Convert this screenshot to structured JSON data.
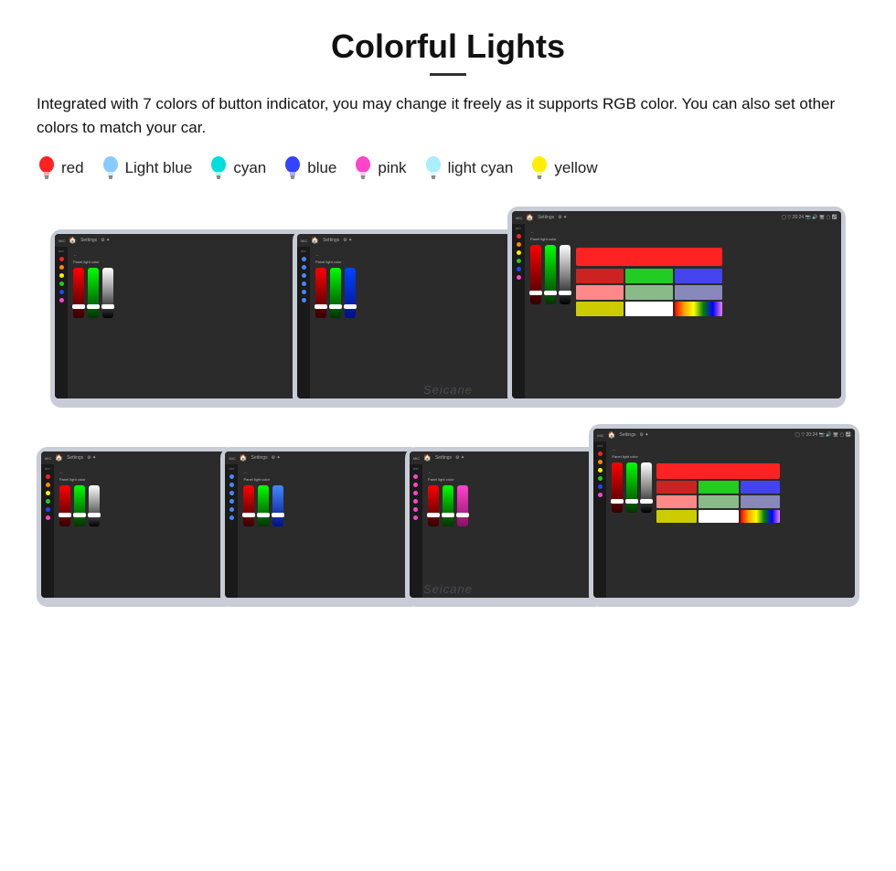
{
  "header": {
    "title": "Colorful Lights",
    "description": "Integrated with 7 colors of button indicator, you may change it freely as it supports RGB color. You can also set other colors to match your car."
  },
  "colors": [
    {
      "name": "red",
      "color": "#ff2222",
      "fill": "#ff2222"
    },
    {
      "name": "Light blue",
      "color": "#88ccff",
      "fill": "#88ccff"
    },
    {
      "name": "cyan",
      "color": "#00dddd",
      "fill": "#00dddd"
    },
    {
      "name": "blue",
      "color": "#3344ff",
      "fill": "#3344ff"
    },
    {
      "name": "pink",
      "color": "#ff44cc",
      "fill": "#ff44cc"
    },
    {
      "name": "light cyan",
      "color": "#aaeeff",
      "fill": "#aaeeff"
    },
    {
      "name": "yellow",
      "color": "#ffee00",
      "fill": "#ffee00"
    }
  ],
  "watermark1": "Seicane",
  "watermark2": "Seicane",
  "screen": {
    "panel_label": "Panel light color",
    "settings": "Settings"
  },
  "sidebar_colors_row1": [
    "#ff2222",
    "#ff8800",
    "#ffee00",
    "#22cc22",
    "#2244ff",
    "#ff44cc"
  ],
  "sidebar_colors_row2_blue": [
    "#4488ff",
    "#4488ff",
    "#4488ff",
    "#4488ff",
    "#4488ff",
    "#4488ff"
  ],
  "sidebar_colors_row2_pink": [
    "#ff44cc",
    "#ff44cc",
    "#ff44cc",
    "#ff44cc",
    "#ff44cc",
    "#ff44cc"
  ]
}
